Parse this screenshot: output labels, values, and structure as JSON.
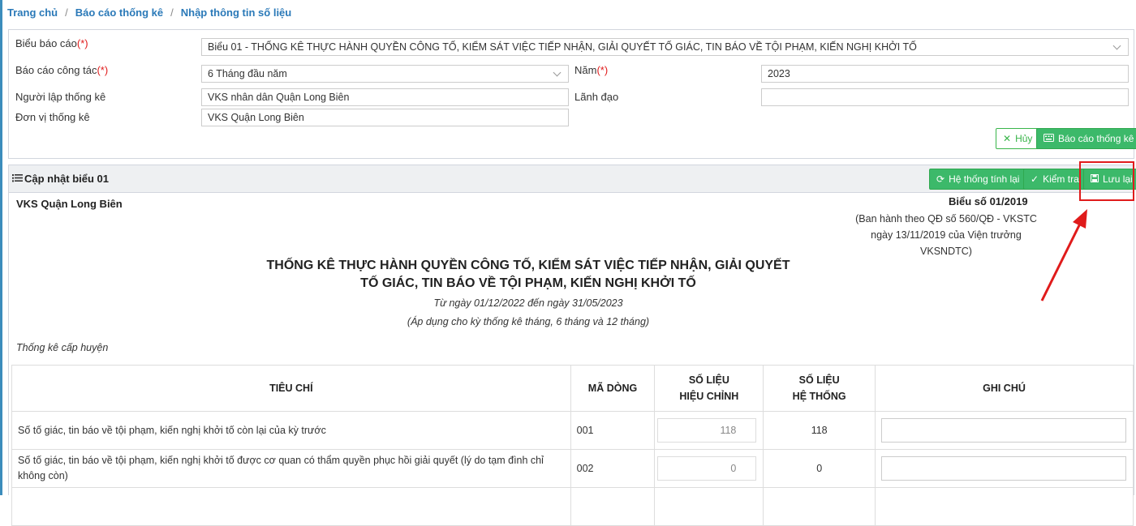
{
  "breadcrumb": {
    "home": "Trang chủ",
    "reports": "Báo cáo thống kê",
    "current": "Nhập thông tin số liệu",
    "separator": "/"
  },
  "filter": {
    "form_label": "Biểu báo cáo",
    "required_mark": "(*)",
    "form_value": "Biểu 01 - THỐNG KÊ THỰC HÀNH QUYỀN CÔNG TỐ, KIỂM SÁT VIỆC TIẾP NHẬN, GIẢI QUYẾT TỐ GIÁC, TIN BÁO VỀ TỘI PHẠM, KIẾN NGHỊ KHỞI TỐ",
    "period_label": "Báo cáo công tác",
    "period_value": "6 Tháng đầu năm",
    "year_label": "Năm",
    "year_value": "2023",
    "creator_label": "Người lập thống kê",
    "creator_value": "VKS nhân dân Quận Long Biên",
    "leader_label": "Lãnh đạo",
    "leader_value": "",
    "unit_label": "Đơn vị thống kê",
    "unit_value": "VKS Quận Long Biên",
    "cancel_label": "Hủy",
    "report_label": "Báo cáo thống kê"
  },
  "section": {
    "title": "Cập nhật biểu 01",
    "recalc_label": "Hệ thống tính lại",
    "check_label": "Kiểm tra",
    "save_label": "Lưu lại"
  },
  "report": {
    "unit_name": "VKS Quận Long Biên",
    "form_no": "Biểu số 01/2019",
    "issued_by": "(Ban hành theo QĐ số 560/QĐ - VKSTC ngày 13/11/2019 của Viện trưởng VKSNDTC)",
    "title_line1": "THỐNG KÊ THỰC HÀNH QUYỀN CÔNG TỐ, KIỂM SÁT VIỆC TIẾP NHẬN, GIẢI QUYẾT",
    "title_line2": "TỐ GIÁC, TIN BÁO VỀ TỘI PHẠM, KIẾN NGHỊ KHỞI TỐ",
    "date_range": "Từ ngày 01/12/2022 đến ngày 31/05/2023",
    "apply_note": "(Áp dụng cho kỳ thống kê tháng, 6 tháng và 12 tháng)",
    "level": "Thống kê cấp huyện"
  },
  "table": {
    "headers": {
      "criteria": "TIÊU CHÍ",
      "code": "MÃ DÒNG",
      "adjusted_1": "SỐ LIỆU",
      "adjusted_2": "HIỆU CHỈNH",
      "system_1": "SỐ LIỆU",
      "system_2": "HỆ THỐNG",
      "note": "GHI CHÚ"
    },
    "rows": [
      {
        "criteria": "Số tố giác, tin báo về tội phạm, kiến nghị khởi tố còn lại của kỳ trước",
        "code": "001",
        "adjusted": "118",
        "system": "118",
        "note": ""
      },
      {
        "criteria": "Số tố giác, tin báo về tội phạm, kiến nghị khởi tố được cơ quan có thẩm quyền phục hồi giải quyết (lý do tạm đình chỉ không còn)",
        "code": "002",
        "adjusted": "0",
        "system": "0",
        "note": ""
      }
    ]
  },
  "icons": {
    "list": "list-icon",
    "refresh": "refresh-icon",
    "check": "check-icon",
    "save": "save-icon",
    "close": "close-icon",
    "keyboard": "keyboard-icon"
  },
  "colors": {
    "link": "#2a79b8",
    "required": "#e01b1b",
    "green_button": "#3cb96a",
    "annotation": "#e01b1b"
  }
}
